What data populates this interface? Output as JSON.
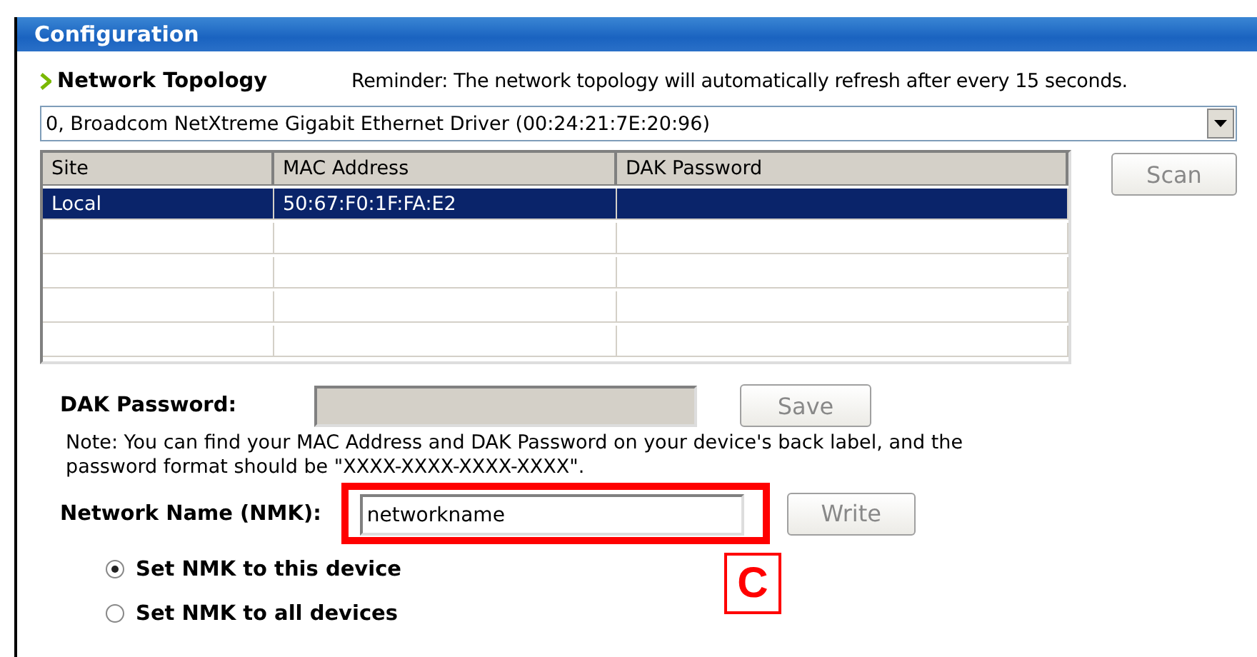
{
  "window": {
    "title": "Configuration"
  },
  "topology": {
    "heading": "Network Topology",
    "reminder": "Reminder: The network topology will automatically refresh after every 15 seconds."
  },
  "adapter": {
    "value": "0, Broadcom NetXtreme Gigabit Ethernet Driver (00:24:21:7E:20:96)"
  },
  "table": {
    "columns": [
      "Site",
      "MAC Address",
      "DAK Password"
    ],
    "rows": [
      {
        "cells": [
          "Local",
          "50:67:F0:1F:FA:E2",
          ""
        ],
        "selected": true
      },
      {
        "cells": [
          "",
          "",
          ""
        ],
        "selected": false
      },
      {
        "cells": [
          "",
          "",
          ""
        ],
        "selected": false
      },
      {
        "cells": [
          "",
          "",
          ""
        ],
        "selected": false
      },
      {
        "cells": [
          "",
          "",
          ""
        ],
        "selected": false
      }
    ]
  },
  "scan_button": {
    "label": "Scan",
    "disabled": true
  },
  "dak": {
    "label": "DAK Password:",
    "disabled": true,
    "button": "Save"
  },
  "note": "Note: You can find your MAC Address and DAK Password on your device's back label, and the password format should be \"XXXX-XXXX-XXXX-XXXX\".",
  "nmk": {
    "label": "Network Name (NMK):",
    "value": "networkname",
    "highlighted": true,
    "button": "Write"
  },
  "radios": [
    {
      "label": "Set NMK to this device",
      "selected": true
    },
    {
      "label": "Set NMK to all devices",
      "selected": false
    }
  ],
  "callout": {
    "label": "C"
  }
}
